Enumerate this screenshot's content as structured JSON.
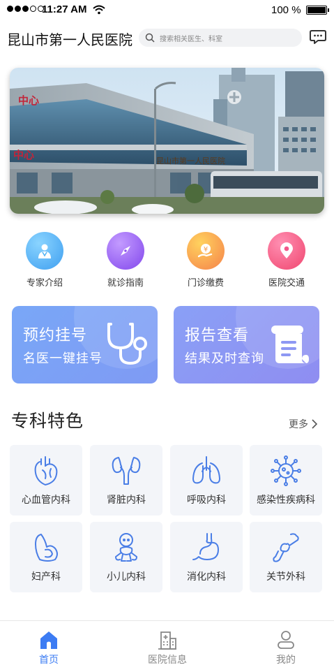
{
  "status_bar": {
    "time": "11:27 AM",
    "battery": "100 %",
    "icons": [
      "signal-dots-icon",
      "wifi-icon",
      "battery-icon"
    ]
  },
  "header": {
    "title": "昆山市第一人民医院",
    "search_placeholder": "搜索相关医生、科室",
    "icons": [
      "search-icon",
      "message-icon"
    ]
  },
  "banner": {
    "image": "hospital-building-photo",
    "sign_text": [
      "中心",
      "中心",
      "昆山市第一人民医院"
    ]
  },
  "quick_menu": [
    {
      "label": "专家介绍",
      "icon": "doctor-icon",
      "color": "#4fb3f5"
    },
    {
      "label": "就诊指南",
      "icon": "compass-icon",
      "color": "#9b5ff2"
    },
    {
      "label": "门诊缴费",
      "icon": "payment-icon",
      "color": "#f7a34a"
    },
    {
      "label": "医院交通",
      "icon": "location-pin-icon",
      "color": "#f2578a"
    }
  ],
  "cards": [
    {
      "title": "预约挂号",
      "subtitle": "名医一键挂号",
      "icon": "stethoscope-icon",
      "color": "#6e9cf6"
    },
    {
      "title": "报告查看",
      "subtitle": "结果及时查询",
      "icon": "report-scroll-icon",
      "color": "#7b8ff3"
    }
  ],
  "section": {
    "title": "专科特色",
    "more": "更多"
  },
  "departments": [
    {
      "label": "心血管内科",
      "icon": "heart-icon"
    },
    {
      "label": "肾脏内科",
      "icon": "kidney-icon"
    },
    {
      "label": "呼吸内科",
      "icon": "lungs-icon"
    },
    {
      "label": "感染性疾病科",
      "icon": "virus-icon"
    },
    {
      "label": "妇产科",
      "icon": "pregnancy-icon"
    },
    {
      "label": "小儿内科",
      "icon": "baby-icon"
    },
    {
      "label": "消化内科",
      "icon": "stomach-icon"
    },
    {
      "label": "关节外科",
      "icon": "joint-icon"
    }
  ],
  "tab_bar": [
    {
      "label": "首页",
      "icon": "home-icon",
      "active": true
    },
    {
      "label": "医院信息",
      "icon": "hospital-icon",
      "active": false
    },
    {
      "label": "我的",
      "icon": "user-icon",
      "active": false
    }
  ],
  "colors": {
    "accent": "#3c7cf3",
    "icon_line": "#4a7ee6",
    "dept_bg": "#f3f5f9"
  }
}
